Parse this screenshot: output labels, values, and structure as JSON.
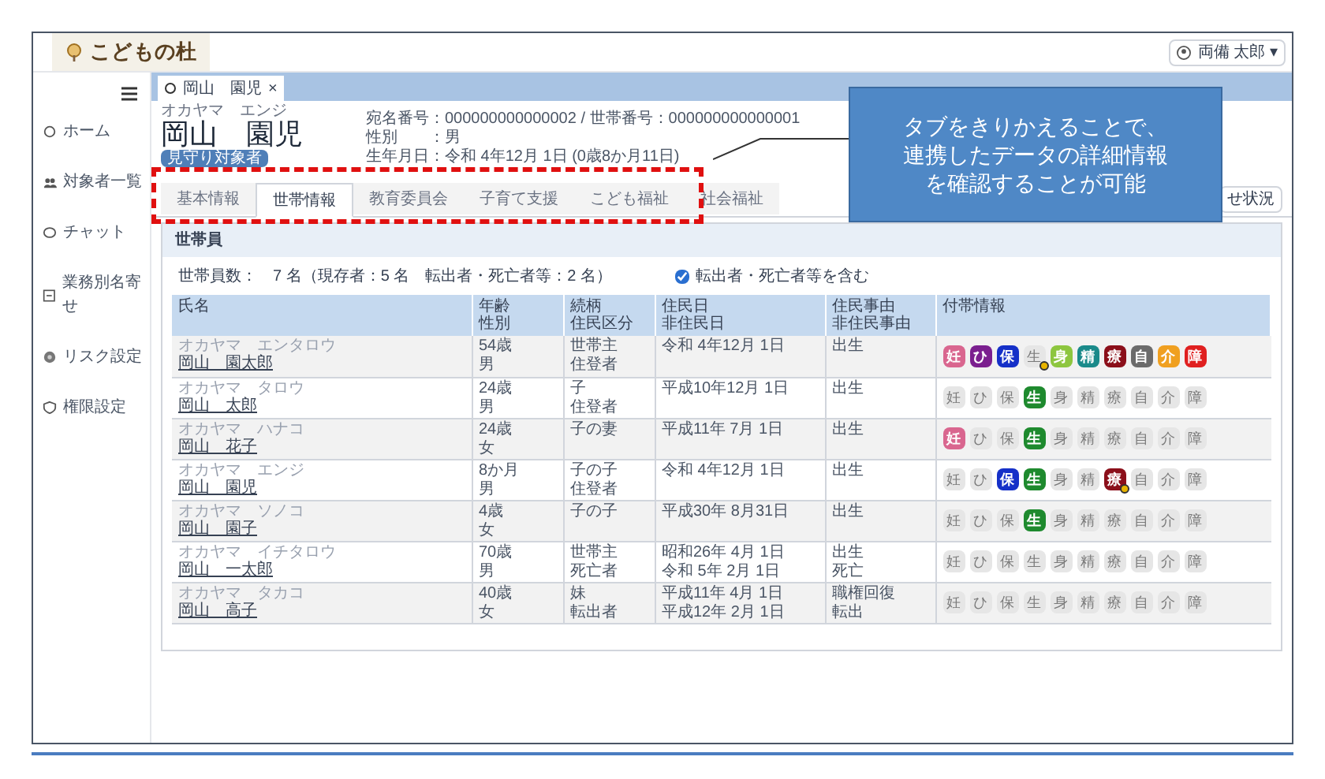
{
  "header": {
    "logo": "こどもの杜",
    "user": "両備 太郎 ▾"
  },
  "sidebar": {
    "items": [
      {
        "label": "ホーム"
      },
      {
        "label": "対象者一覧"
      },
      {
        "label": "チャット"
      },
      {
        "label": "業務別名寄せ"
      },
      {
        "label": "リスク設定"
      },
      {
        "label": "権限設定"
      }
    ]
  },
  "open_tab": {
    "label": "岡山　園児",
    "close": "×"
  },
  "person": {
    "kana": "オカヤマ　エンジ",
    "name": "岡山　園児",
    "badge": "見守り対象者",
    "info": [
      "宛名番号：000000000000002 / 世帯番号：000000000000001",
      "性別　　：男",
      "生年月日：令和 4年12月 1日 (0歳8か月11日)"
    ]
  },
  "tabs": [
    {
      "label": "基本情報",
      "selected": false
    },
    {
      "label": "世帯情報",
      "selected": true
    },
    {
      "label": "教育委員会",
      "selected": false
    },
    {
      "label": "子育て支援",
      "selected": false
    },
    {
      "label": "こども福祉",
      "selected": false
    },
    {
      "label": "社会福祉",
      "selected": false
    }
  ],
  "right_button": "せ状況",
  "callout": [
    "タブをきりかえることで、",
    "連携したデータの詳細情報",
    "を確認することが可能"
  ],
  "section": {
    "title": "世帯員",
    "count": "世帯員数：　7 名（現存者：5 名　転出者・死亡者等：2 名）",
    "include_checkbox": {
      "label": "転出者・死亡者等を含む",
      "checked": true
    }
  },
  "table": {
    "columns": [
      [
        "氏名"
      ],
      [
        "年齢",
        "性別"
      ],
      [
        "続柄",
        "住民区分"
      ],
      [
        "住民日",
        "非住民日"
      ],
      [
        "住民事由",
        "非住民事由"
      ],
      [
        "付帯情報"
      ]
    ],
    "rows": [
      {
        "kana": "オカヤマ　エンタロウ",
        "name": "岡山　園太郎",
        "age": [
          "54歳",
          "男"
        ],
        "relation": [
          "世帯主",
          "住登者"
        ],
        "dates": [
          "令和 4年12月 1日"
        ],
        "reason": [
          "出生"
        ],
        "badges": [
          {
            "label": "妊",
            "active": true,
            "color": "#d9668f",
            "flag": false
          },
          {
            "label": "ひ",
            "active": true,
            "color": "#7b1f8f",
            "flag": false
          },
          {
            "label": "保",
            "active": true,
            "color": "#1530c8",
            "flag": false
          },
          {
            "label": "生",
            "active": false,
            "flag": true
          },
          {
            "label": "身",
            "active": true,
            "color": "#8dc63f",
            "flag": false
          },
          {
            "label": "精",
            "active": true,
            "color": "#1a8a8a",
            "flag": false
          },
          {
            "label": "療",
            "active": true,
            "color": "#8b0f1a",
            "flag": false
          },
          {
            "label": "自",
            "active": true,
            "color": "#6b6b6b",
            "flag": false
          },
          {
            "label": "介",
            "active": true,
            "color": "#f0a020",
            "flag": false
          },
          {
            "label": "障",
            "active": true,
            "color": "#e02020",
            "flag": false
          }
        ]
      },
      {
        "kana": "オカヤマ　タロウ",
        "name": "岡山　太郎",
        "age": [
          "24歳",
          "男"
        ],
        "relation": [
          "子",
          "住登者"
        ],
        "dates": [
          "平成10年12月 1日"
        ],
        "reason": [
          "出生"
        ],
        "badges": [
          {
            "label": "妊",
            "active": false,
            "flag": false
          },
          {
            "label": "ひ",
            "active": false,
            "flag": false
          },
          {
            "label": "保",
            "active": false,
            "flag": false
          },
          {
            "label": "生",
            "active": true,
            "color": "#1e8a2e",
            "flag": false
          },
          {
            "label": "身",
            "active": false,
            "flag": false
          },
          {
            "label": "精",
            "active": false,
            "flag": false
          },
          {
            "label": "療",
            "active": false,
            "flag": false
          },
          {
            "label": "自",
            "active": false,
            "flag": false
          },
          {
            "label": "介",
            "active": false,
            "flag": false
          },
          {
            "label": "障",
            "active": false,
            "flag": false
          }
        ]
      },
      {
        "kana": "オカヤマ　ハナコ",
        "name": "岡山　花子",
        "age": [
          "24歳",
          "女"
        ],
        "relation": [
          "子の妻"
        ],
        "dates": [
          "平成11年 7月 1日"
        ],
        "reason": [
          "出生"
        ],
        "badges": [
          {
            "label": "妊",
            "active": true,
            "color": "#d9668f",
            "flag": false
          },
          {
            "label": "ひ",
            "active": false,
            "flag": false
          },
          {
            "label": "保",
            "active": false,
            "flag": false
          },
          {
            "label": "生",
            "active": true,
            "color": "#1e8a2e",
            "flag": false
          },
          {
            "label": "身",
            "active": false,
            "flag": false
          },
          {
            "label": "精",
            "active": false,
            "flag": false
          },
          {
            "label": "療",
            "active": false,
            "flag": false
          },
          {
            "label": "自",
            "active": false,
            "flag": false
          },
          {
            "label": "介",
            "active": false,
            "flag": false
          },
          {
            "label": "障",
            "active": false,
            "flag": false
          }
        ]
      },
      {
        "kana": "オカヤマ　エンジ",
        "name": "岡山　園児",
        "age": [
          "8か月",
          "男"
        ],
        "relation": [
          "子の子",
          "住登者"
        ],
        "dates": [
          "令和 4年12月 1日"
        ],
        "reason": [
          "出生"
        ],
        "badges": [
          {
            "label": "妊",
            "active": false,
            "flag": false
          },
          {
            "label": "ひ",
            "active": false,
            "flag": false
          },
          {
            "label": "保",
            "active": true,
            "color": "#1530c8",
            "flag": false
          },
          {
            "label": "生",
            "active": true,
            "color": "#1e8a2e",
            "flag": false
          },
          {
            "label": "身",
            "active": false,
            "flag": false
          },
          {
            "label": "精",
            "active": false,
            "flag": false
          },
          {
            "label": "療",
            "active": true,
            "color": "#8b0f1a",
            "flag": true
          },
          {
            "label": "自",
            "active": false,
            "flag": false
          },
          {
            "label": "介",
            "active": false,
            "flag": false
          },
          {
            "label": "障",
            "active": false,
            "flag": false
          }
        ]
      },
      {
        "kana": "オカヤマ　ソノコ",
        "name": "岡山　園子",
        "age": [
          "4歳",
          "女"
        ],
        "relation": [
          "子の子"
        ],
        "dates": [
          "平成30年 8月31日"
        ],
        "reason": [
          "出生"
        ],
        "badges": [
          {
            "label": "妊",
            "active": false,
            "flag": false
          },
          {
            "label": "ひ",
            "active": false,
            "flag": false
          },
          {
            "label": "保",
            "active": false,
            "flag": false
          },
          {
            "label": "生",
            "active": true,
            "color": "#1e8a2e",
            "flag": false
          },
          {
            "label": "身",
            "active": false,
            "flag": false
          },
          {
            "label": "精",
            "active": false,
            "flag": false
          },
          {
            "label": "療",
            "active": false,
            "flag": false
          },
          {
            "label": "自",
            "active": false,
            "flag": false
          },
          {
            "label": "介",
            "active": false,
            "flag": false
          },
          {
            "label": "障",
            "active": false,
            "flag": false
          }
        ]
      },
      {
        "kana": "オカヤマ　イチタロウ",
        "name": "岡山　一太郎",
        "age": [
          "70歳",
          "男"
        ],
        "relation": [
          "世帯主",
          "死亡者"
        ],
        "dates": [
          "昭和26年 4月 1日",
          "令和 5年 2月 1日"
        ],
        "reason": [
          "出生",
          "死亡"
        ],
        "badges": [
          {
            "label": "妊",
            "active": false,
            "flag": false
          },
          {
            "label": "ひ",
            "active": false,
            "flag": false
          },
          {
            "label": "保",
            "active": false,
            "flag": false
          },
          {
            "label": "生",
            "active": false,
            "flag": false
          },
          {
            "label": "身",
            "active": false,
            "flag": false
          },
          {
            "label": "精",
            "active": false,
            "flag": false
          },
          {
            "label": "療",
            "active": false,
            "flag": false
          },
          {
            "label": "自",
            "active": false,
            "flag": false
          },
          {
            "label": "介",
            "active": false,
            "flag": false
          },
          {
            "label": "障",
            "active": false,
            "flag": false
          }
        ]
      },
      {
        "kana": "オカヤマ　タカコ",
        "name": "岡山　高子",
        "age": [
          "40歳",
          "女"
        ],
        "relation": [
          "妹",
          "転出者"
        ],
        "dates": [
          "平成11年 4月 1日",
          "平成12年 2月 1日"
        ],
        "reason": [
          "職権回復",
          "転出"
        ],
        "badges": [
          {
            "label": "妊",
            "active": false,
            "flag": false
          },
          {
            "label": "ひ",
            "active": false,
            "flag": false
          },
          {
            "label": "保",
            "active": false,
            "flag": false
          },
          {
            "label": "生",
            "active": false,
            "flag": false
          },
          {
            "label": "身",
            "active": false,
            "flag": false
          },
          {
            "label": "精",
            "active": false,
            "flag": false
          },
          {
            "label": "療",
            "active": false,
            "flag": false
          },
          {
            "label": "自",
            "active": false,
            "flag": false
          },
          {
            "label": "介",
            "active": false,
            "flag": false
          },
          {
            "label": "障",
            "active": false,
            "flag": false
          }
        ]
      }
    ]
  }
}
